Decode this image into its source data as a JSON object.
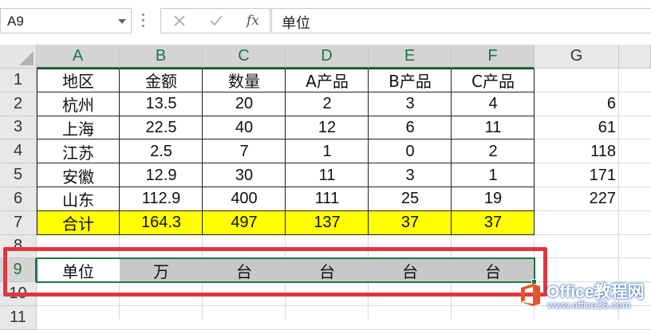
{
  "formula_bar": {
    "name_box": "A9",
    "cancel_icon": "close-icon",
    "enter_icon": "check-icon",
    "fx_label": "fx",
    "formula_value": "单位"
  },
  "columns": [
    "A",
    "B",
    "C",
    "D",
    "E",
    "F",
    "G"
  ],
  "rows": [
    "1",
    "2",
    "3",
    "4",
    "5",
    "6",
    "7",
    "8",
    "9",
    "10",
    "11"
  ],
  "table": {
    "header": [
      "地区",
      "金额",
      "数量",
      "A产品",
      "B产品",
      "C产品"
    ],
    "data": [
      [
        "杭州",
        "13.5",
        "20",
        "2",
        "3",
        "4"
      ],
      [
        "上海",
        "22.5",
        "40",
        "12",
        "6",
        "11"
      ],
      [
        "江苏",
        "2.5",
        "7",
        "1",
        "0",
        "2"
      ],
      [
        "安徽",
        "12.9",
        "30",
        "11",
        "3",
        "1"
      ],
      [
        "山东",
        "112.9",
        "400",
        "111",
        "25",
        "19"
      ]
    ],
    "total": [
      "合计",
      "164.3",
      "497",
      "137",
      "37",
      "37"
    ]
  },
  "column_g": [
    "6",
    "61",
    "118",
    "171",
    "227"
  ],
  "unit_row": [
    "单位",
    "万",
    "台",
    "台",
    "台",
    "台"
  ],
  "watermark": {
    "title": "Office教程网",
    "url": "www.office26.com"
  },
  "colors": {
    "excel_green": "#217346",
    "total_row_fill": "#ffff00",
    "highlight_red": "#e0373f",
    "selection_gray": "#c8c8c8"
  }
}
